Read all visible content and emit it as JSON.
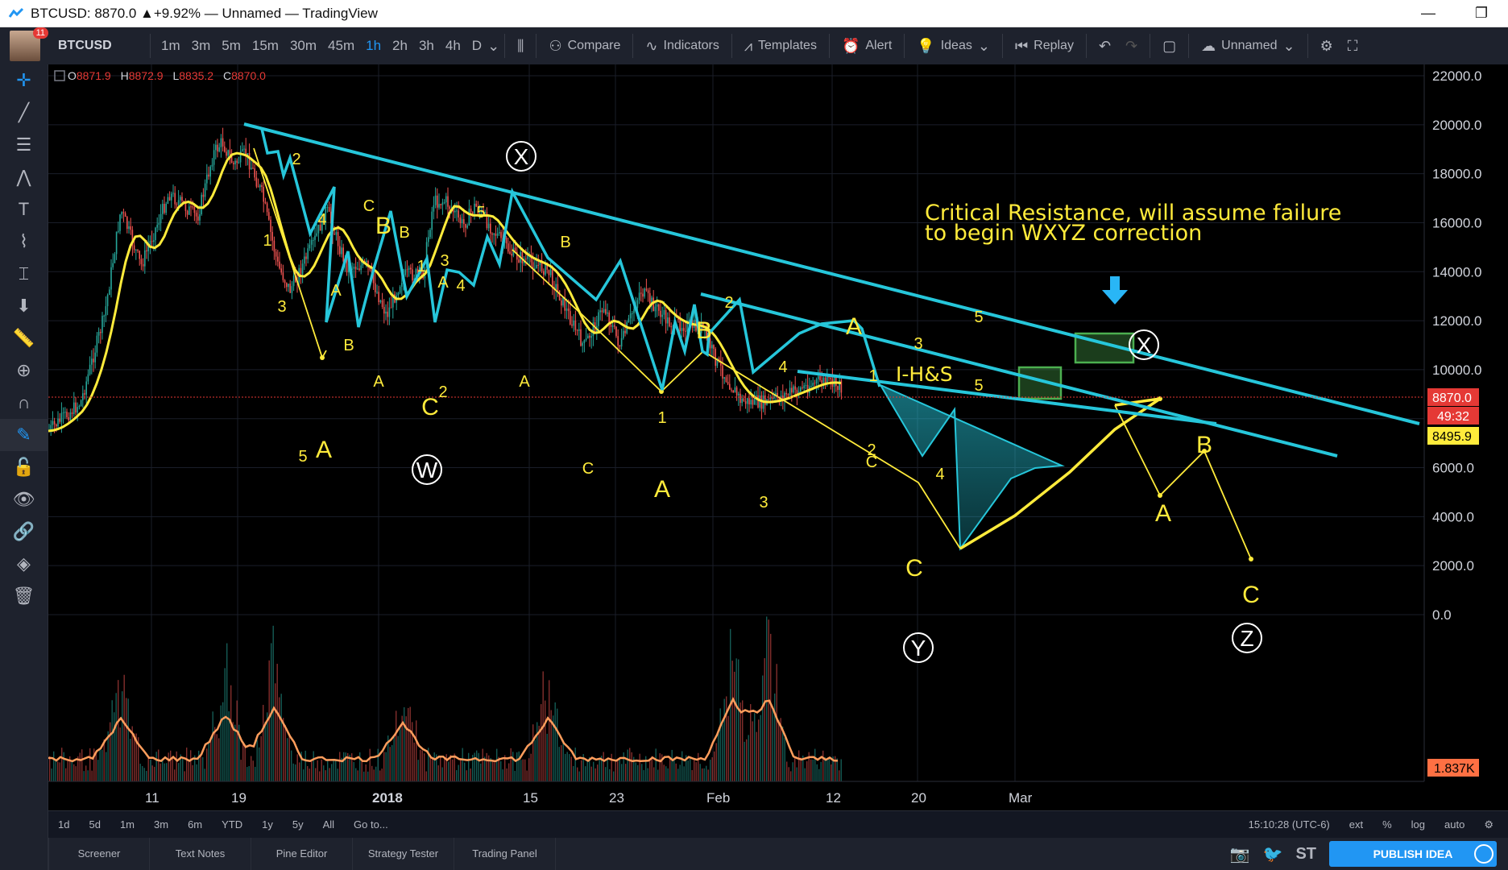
{
  "window": {
    "title": "BTCUSD: 8870.0 ▲+9.92% — Unnamed — TradingView",
    "controls": [
      "—",
      "❐"
    ]
  },
  "toolbar": {
    "notifications": "11",
    "symbol": "BTCUSD",
    "timeframes": [
      "1m",
      "3m",
      "5m",
      "15m",
      "30m",
      "45m",
      "1h",
      "2h",
      "3h",
      "4h",
      "D"
    ],
    "active_timeframe": "1h",
    "compare": "Compare",
    "indicators": "Indicators",
    "templates": "Templates",
    "alert": "Alert",
    "ideas": "Ideas",
    "replay": "Replay",
    "layout_name": "Unnamed"
  },
  "ohlc": {
    "o_label": "O",
    "o": "8871.9",
    "h_label": "H",
    "h": "8872.9",
    "l_label": "L",
    "l": "8835.2",
    "c_label": "C",
    "c": "8870.0"
  },
  "price_axis": {
    "ticks": [
      "22000.0",
      "20000.0",
      "18000.0",
      "16000.0",
      "14000.0",
      "12000.0",
      "10000.0",
      "8000.0",
      "6000.0",
      "4000.0",
      "2000.0",
      "0.0"
    ],
    "last_price": "8870.0",
    "countdown": "49:32",
    "ma_value": "8495.9",
    "volume_value": "1.837K"
  },
  "time_axis": {
    "ticks": [
      "11",
      "19",
      "2018",
      "15",
      "23",
      "Feb",
      "12",
      "20",
      "Mar"
    ]
  },
  "annotation": {
    "line1": "Critical Resistance, will assume failure",
    "line2": "to begin WXYZ correction",
    "pattern": "I-H&S"
  },
  "wave_labels": {
    "circled": [
      "X",
      "W",
      "Y",
      "X",
      "Z"
    ],
    "major": [
      "B",
      "A",
      "C",
      "B",
      "A",
      "C",
      "A",
      "B",
      "C",
      "A"
    ],
    "minor": [
      "2",
      "4",
      "1",
      "3",
      "5",
      "C",
      "A",
      "B",
      "1",
      "B",
      "A",
      "A",
      "3",
      "4",
      "2",
      "5",
      "B",
      "A",
      "C",
      "1",
      "2",
      "C",
      "4",
      "3",
      "1",
      "2",
      "5",
      "3",
      "4",
      "5"
    ]
  },
  "bottom_bar": {
    "ranges": [
      "1d",
      "5d",
      "1m",
      "3m",
      "6m",
      "YTD",
      "1y",
      "5y",
      "All",
      "Go to..."
    ],
    "clock": "15:10:28 (UTC-6)",
    "options": [
      "ext",
      "%",
      "log",
      "auto"
    ]
  },
  "panels": {
    "tabs": [
      "Screener",
      "Text Notes",
      "Pine Editor",
      "Strategy Tester",
      "Trading Panel"
    ],
    "st_label": "ST",
    "publish": "PUBLISH IDEA"
  },
  "colors": {
    "cyan": "#26c6da",
    "yellow": "#ffeb3b",
    "green_box": "#4caf50",
    "price_tag": "#e53935",
    "accent": "#2196f3"
  },
  "chart_data": {
    "type": "line",
    "title": "BTCUSD 1h",
    "ylim": [
      0,
      22000
    ],
    "x": [
      "11",
      "19",
      "2018",
      "15",
      "23",
      "Feb",
      "12",
      "20",
      "Mar"
    ],
    "series": [
      {
        "name": "price",
        "values": [
          10500,
          19800,
          13500,
          17000,
          9500,
          11500,
          6300,
          8870
        ]
      }
    ]
  }
}
